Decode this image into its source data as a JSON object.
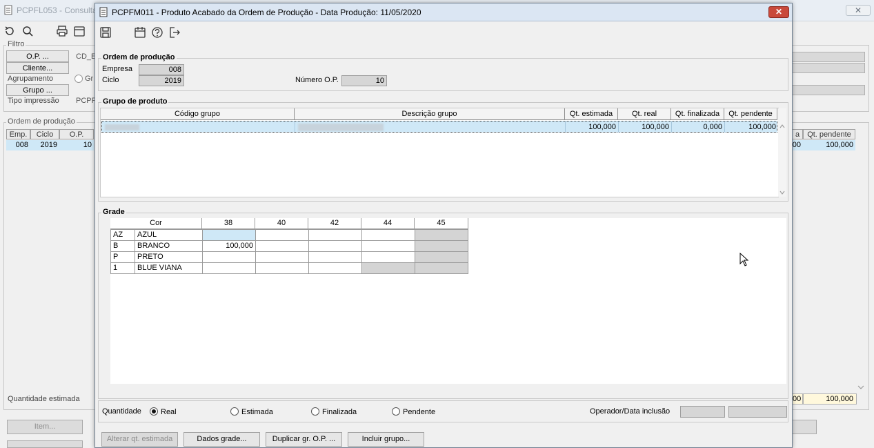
{
  "bg": {
    "title": "PCPFL053 - Consulta",
    "filter_label": "Filtro",
    "op_btn": "O.P. ...",
    "cliente_btn": "Cliente...",
    "agrupamento_label": "Agrupamento",
    "agrupamento_radio": "Gr",
    "grupo_btn": "Grupo ...",
    "tipo_impressao_label": "Tipo impressão",
    "tipo_impressao_value": "PCPR",
    "cd_field": "CD_E",
    "ordem_label": "Ordem de produção",
    "grid_headers": [
      "Emp.",
      "Ciclo",
      "O.P."
    ],
    "grid_row": [
      "008",
      "2019",
      "10"
    ],
    "right_headers": [
      "a",
      "Qt. pendente"
    ],
    "right_row": [
      "00",
      "100,000"
    ],
    "qtd_estimada_label": "Quantidade estimada",
    "qtd_right": [
      "00",
      "100,000"
    ],
    "item_btn": "Item..."
  },
  "modal": {
    "title": "PCPFM011 - Produto Acabado da Ordem de Produção - Data Produção: 11/05/2020",
    "close_label": "✕",
    "ordem": {
      "label": "Ordem de produção",
      "empresa_label": "Empresa",
      "empresa_value": "008",
      "ciclo_label": "Ciclo",
      "ciclo_value": "2019",
      "numero_op_label": "Número O.P.",
      "numero_op_value": "10"
    },
    "grupo": {
      "label": "Grupo de produto",
      "headers": [
        "Código grupo",
        "Descrição grupo",
        "Qt. estimada",
        "Qt. real",
        "Qt. finalizada",
        "Qt. pendente"
      ],
      "row": {
        "qt_estimada": "100,000",
        "qt_real": "100,000",
        "qt_finalizada": "0,000",
        "qt_pendente": "100,000"
      }
    },
    "grade": {
      "label": "Grade",
      "cor_header": "Cor",
      "sizes": [
        "38",
        "40",
        "42",
        "44",
        "45"
      ],
      "rows": [
        {
          "code": "AZ",
          "name": "AZUL",
          "values": [
            "",
            "",
            "",
            "",
            ""
          ]
        },
        {
          "code": "B",
          "name": "BRANCO",
          "values": [
            "100,000",
            "",
            "",
            "",
            ""
          ]
        },
        {
          "code": "P",
          "name": "PRETO",
          "values": [
            "",
            "",
            "",
            "",
            ""
          ]
        },
        {
          "code": "1",
          "name": "BLUE VIANA",
          "values": [
            "",
            "",
            "",
            "",
            ""
          ]
        }
      ]
    },
    "quantidade": {
      "label": "Quantidade",
      "options": [
        "Real",
        "Estimada",
        "Finalizada",
        "Pendente"
      ],
      "selected": "Real",
      "operador_label": "Operador/Data inclusão"
    },
    "buttons": {
      "alterar": "Alterar qt. estimada",
      "dados": "Dados grade...",
      "duplicar": "Duplicar gr. O.P. ...",
      "incluir": "Incluir grupo..."
    }
  }
}
